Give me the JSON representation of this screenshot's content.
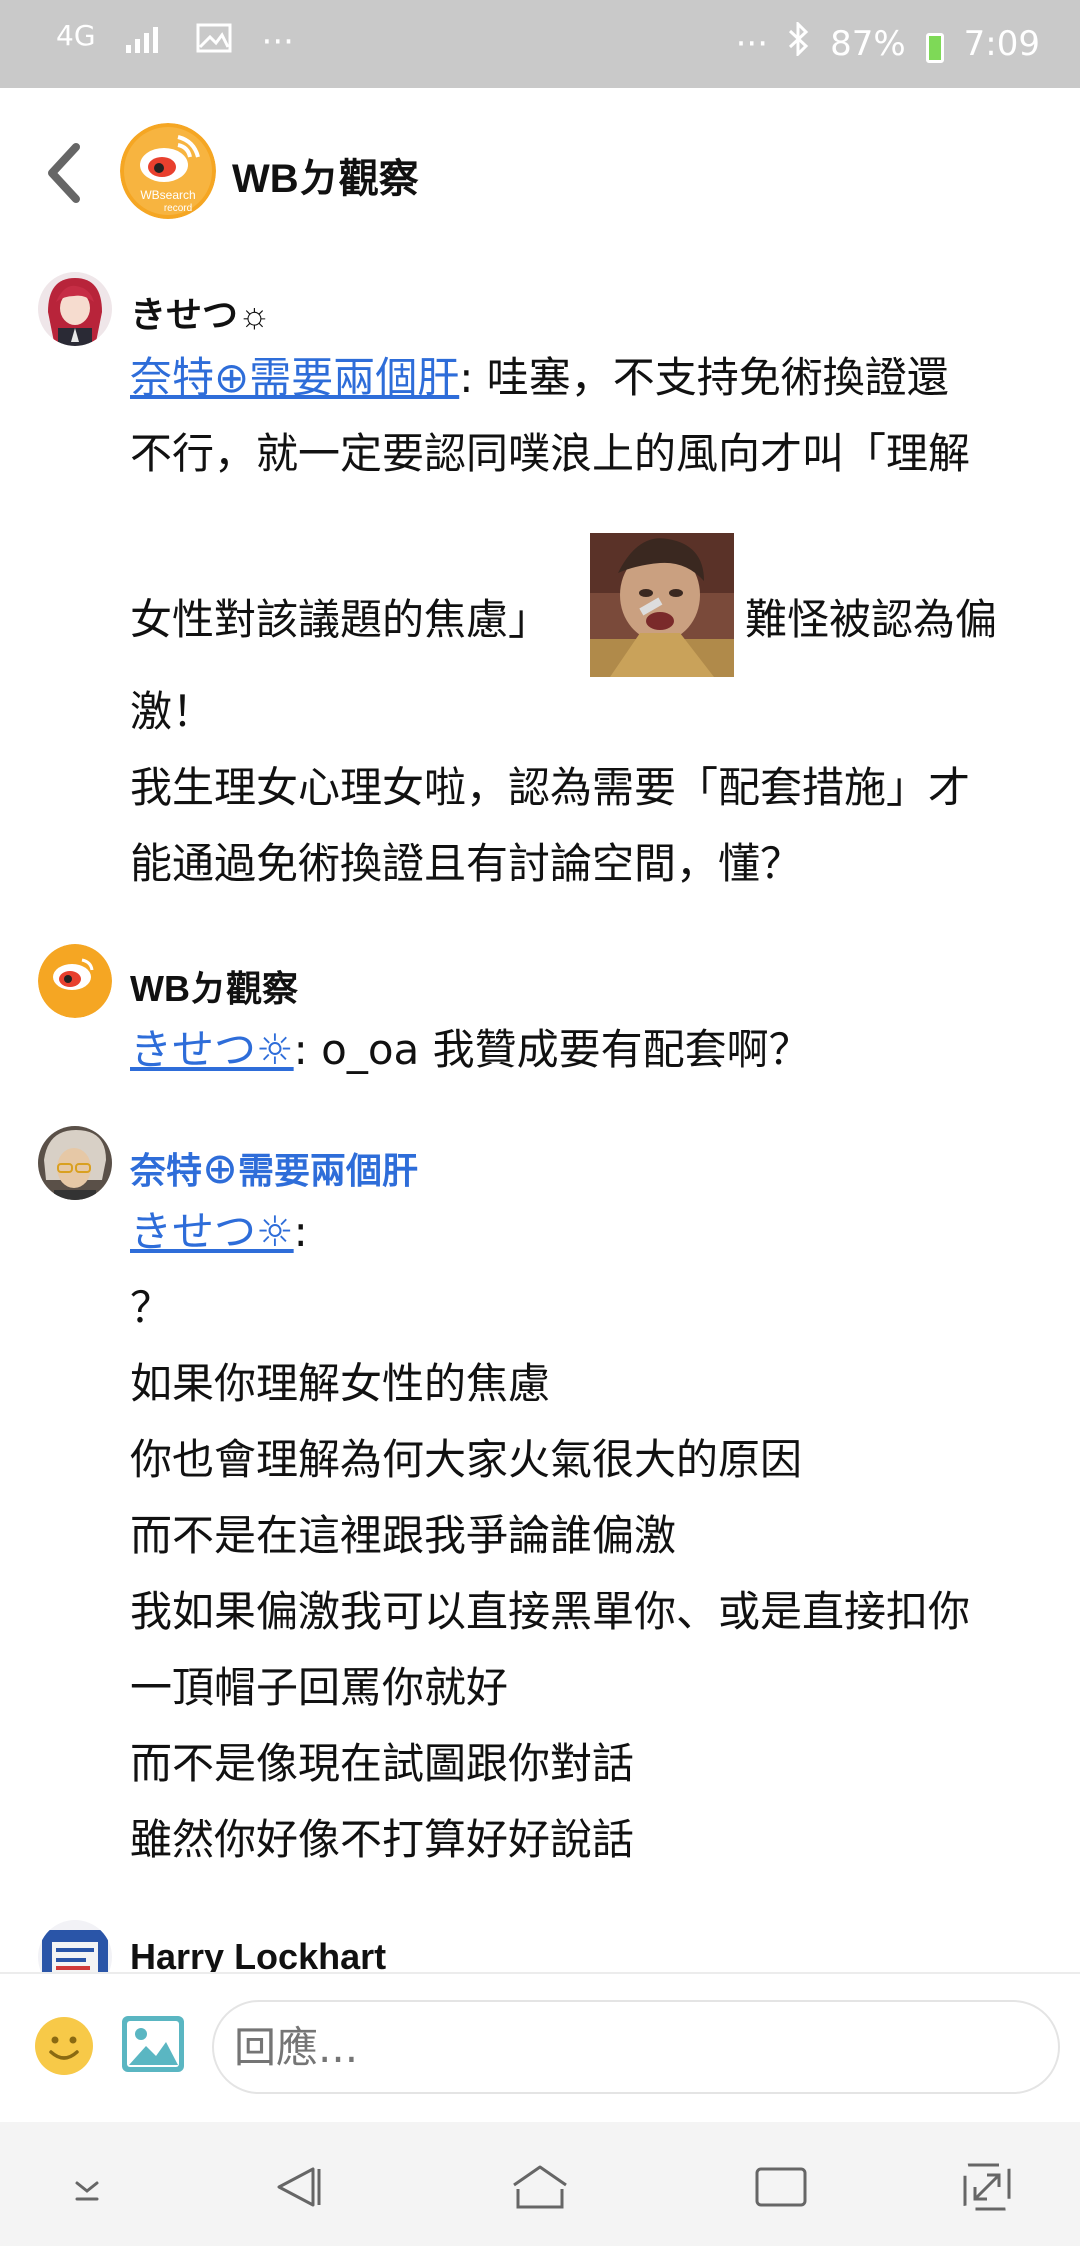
{
  "status_bar": {
    "network": "4G",
    "overflow_left": "···",
    "overflow_right": "···",
    "battery": "87%",
    "time": "7:09"
  },
  "header": {
    "title": "WBㄉ觀察",
    "avatar_text_1": "WBsearch",
    "avatar_text_2": "record",
    "back_icon": "chevron-left-icon"
  },
  "messages": [
    {
      "author": "きせつ☼",
      "lines": [
        {
          "mention": "奈特⊕需要兩個肝",
          "text": ": 哇塞，不支持免術換證還"
        },
        {
          "text": "不行，就一定要認同噗浪上的風向才叫「理解"
        },
        {
          "text": "女性對該議題的焦慮」"
        },
        {
          "text": "難怪被認為偏"
        },
        {
          "text": "激！"
        },
        {
          "text": "我生理女心理女啦，認為需要「配套措施」才"
        },
        {
          "text": "能通過免術換證且有討論空間，懂？"
        }
      ]
    },
    {
      "author": "WBㄉ觀察",
      "lines": [
        {
          "mention": "きせつ☼",
          "text": ": o_oa 我贊成要有配套啊？"
        }
      ]
    },
    {
      "author": "奈特⊕需要兩個肝",
      "lines": [
        {
          "mention": "きせつ☼",
          "text": ":"
        },
        {
          "text": "？"
        },
        {
          "text": "如果你理解女性的焦慮"
        },
        {
          "text": "你也會理解為何大家火氣很大的原因"
        },
        {
          "text": "而不是在這裡跟我爭論誰偏激"
        },
        {
          "text": "我如果偏激我可以直接黑單你、或是直接扣你"
        },
        {
          "text": "一頂帽子回罵你就好"
        },
        {
          "text": "而不是像現在試圖跟你對話"
        },
        {
          "text": "雖然你好像不打算好好說話"
        }
      ]
    },
    {
      "author": "Harry Lockhart"
    }
  ],
  "reply_bar": {
    "placeholder": "回應...",
    "emoji_icon": "emoji-icon",
    "image_icon": "image-icon"
  },
  "nav_bar": {
    "icons": [
      "hide-keyboard-icon",
      "back-icon",
      "home-icon",
      "recents-icon",
      "expand-icon"
    ]
  },
  "colors": {
    "link": "#2e6dd9",
    "status_bar_bg": "#c9c9c9",
    "brand_orange": "#f5a623"
  }
}
